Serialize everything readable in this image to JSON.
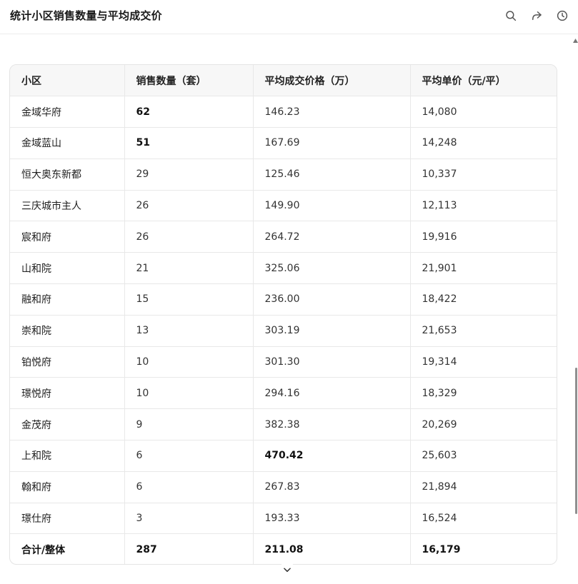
{
  "header": {
    "title": "统计小区销售数量与平均成交价",
    "icons": [
      "search-icon",
      "share-icon",
      "history-icon"
    ]
  },
  "table": {
    "columns": [
      "小区",
      "销售数量（套）",
      "平均成交价格（万）",
      "平均单价（元/平）"
    ],
    "rows": [
      {
        "name": "金域华府",
        "count": "62",
        "avg_price": "146.23",
        "unit_price": "14,080",
        "bold": [
          "count"
        ]
      },
      {
        "name": "金域蓝山",
        "count": "51",
        "avg_price": "167.69",
        "unit_price": "14,248",
        "bold": [
          "count"
        ]
      },
      {
        "name": "恒大奥东新都",
        "count": "29",
        "avg_price": "125.46",
        "unit_price": "10,337",
        "bold": []
      },
      {
        "name": "三庆城市主人",
        "count": "26",
        "avg_price": "149.90",
        "unit_price": "12,113",
        "bold": []
      },
      {
        "name": "宸和府",
        "count": "26",
        "avg_price": "264.72",
        "unit_price": "19,916",
        "bold": []
      },
      {
        "name": "山和院",
        "count": "21",
        "avg_price": "325.06",
        "unit_price": "21,901",
        "bold": []
      },
      {
        "name": "融和府",
        "count": "15",
        "avg_price": "236.00",
        "unit_price": "18,422",
        "bold": []
      },
      {
        "name": "崇和院",
        "count": "13",
        "avg_price": "303.19",
        "unit_price": "21,653",
        "bold": []
      },
      {
        "name": "铂悦府",
        "count": "10",
        "avg_price": "301.30",
        "unit_price": "19,314",
        "bold": []
      },
      {
        "name": "璟悦府",
        "count": "10",
        "avg_price": "294.16",
        "unit_price": "18,329",
        "bold": []
      },
      {
        "name": "金茂府",
        "count": "9",
        "avg_price": "382.38",
        "unit_price": "20,269",
        "bold": []
      },
      {
        "name": "上和院",
        "count": "6",
        "avg_price": "470.42",
        "unit_price": "25,603",
        "bold": [
          "avg_price"
        ]
      },
      {
        "name": "翰和府",
        "count": "6",
        "avg_price": "267.83",
        "unit_price": "21,894",
        "bold": []
      },
      {
        "name": "璟仕府",
        "count": "3",
        "avg_price": "193.33",
        "unit_price": "16,524",
        "bold": []
      }
    ],
    "total": {
      "name": "合计/整体",
      "count": "287",
      "avg_price": "211.08",
      "unit_price": "16,179"
    }
  },
  "controls": {
    "expand_icon": "chevron-down-icon"
  }
}
